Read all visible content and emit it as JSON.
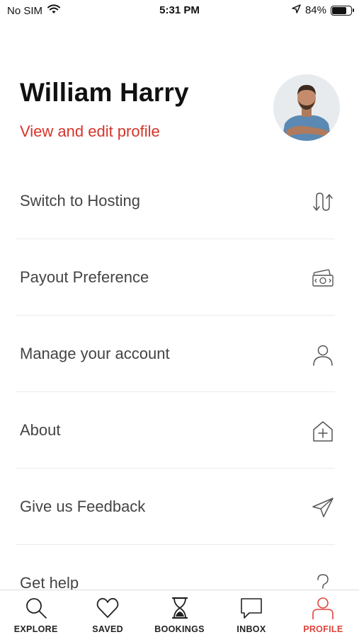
{
  "status_bar": {
    "carrier": "No SIM",
    "time": "5:31 PM",
    "battery_percent": "84%",
    "battery_level": 0.84
  },
  "profile": {
    "name": "William Harry",
    "edit_link": "View and edit profile"
  },
  "menu": {
    "items": [
      {
        "label": "Switch to Hosting",
        "icon": "switch-arrows-icon"
      },
      {
        "label": "Payout Preference",
        "icon": "money-icon"
      },
      {
        "label": "Manage your account",
        "icon": "person-icon"
      },
      {
        "label": "About",
        "icon": "home-plus-icon"
      },
      {
        "label": "Give us Feedback",
        "icon": "paper-plane-icon"
      },
      {
        "label": "Get help",
        "icon": "question-icon"
      }
    ]
  },
  "tab_bar": {
    "tabs": [
      {
        "label": "EXPLORE",
        "icon": "search-icon",
        "active": false
      },
      {
        "label": "SAVED",
        "icon": "heart-icon",
        "active": false
      },
      {
        "label": "BOOKINGS",
        "icon": "hourglass-icon",
        "active": false
      },
      {
        "label": "INBOX",
        "icon": "chat-bubble-icon",
        "active": false
      },
      {
        "label": "PROFILE",
        "icon": "person-icon",
        "active": true
      }
    ]
  },
  "colors": {
    "accent": "#e0443c",
    "edit_link": "#d6342a"
  }
}
